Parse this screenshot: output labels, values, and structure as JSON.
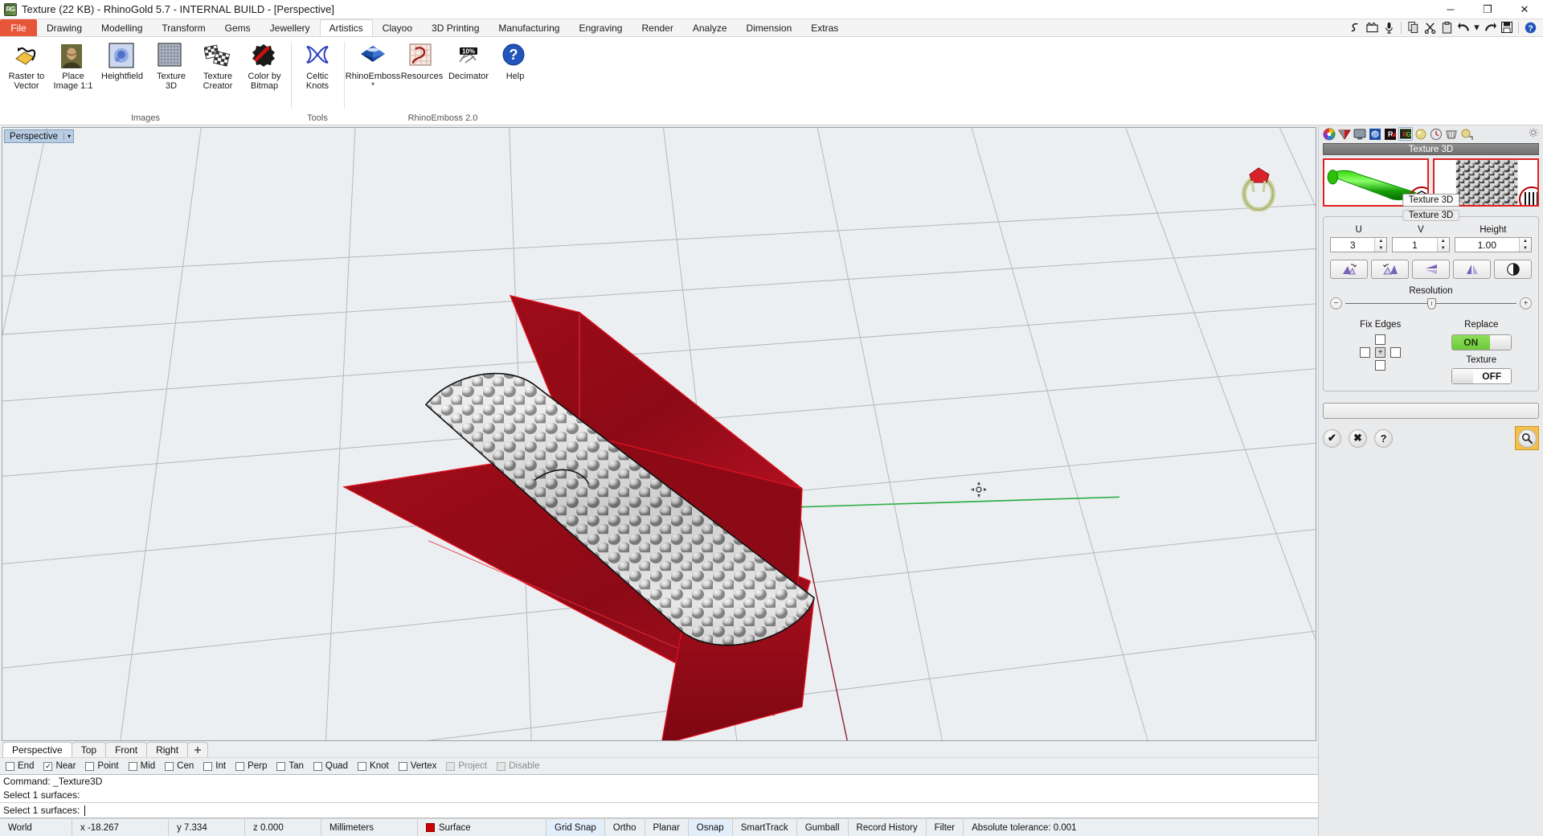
{
  "window": {
    "title": "Texture (22 KB) - RhinoGold 5.7 - INTERNAL BUILD - [Perspective]",
    "app_icon": "RG",
    "minimize": "─",
    "restore": "❐",
    "close": "✕"
  },
  "ribbon": {
    "file_tab": "File",
    "tabs": [
      {
        "label": "Drawing",
        "active": false
      },
      {
        "label": "Modelling",
        "active": false
      },
      {
        "label": "Transform",
        "active": false
      },
      {
        "label": "Gems",
        "active": false
      },
      {
        "label": "Jewellery",
        "active": false
      },
      {
        "label": "Artistics",
        "active": true
      },
      {
        "label": "Clayoo",
        "active": false
      },
      {
        "label": "3D Printing",
        "active": false
      },
      {
        "label": "Manufacturing",
        "active": false
      },
      {
        "label": "Engraving",
        "active": false
      },
      {
        "label": "Render",
        "active": false
      },
      {
        "label": "Analyze",
        "active": false
      },
      {
        "label": "Dimension",
        "active": false
      },
      {
        "label": "Extras",
        "active": false
      }
    ],
    "quick_access": [
      {
        "icon": "curve-icon",
        "glyph": "Ɛ"
      },
      {
        "icon": "animation-icon",
        "glyph": "🎬"
      },
      {
        "icon": "microphone-icon",
        "glyph": "🎤"
      },
      {
        "icon": "copy-icon",
        "glyph": "❐"
      },
      {
        "icon": "cut-icon",
        "glyph": "✂"
      },
      {
        "icon": "paste-icon",
        "glyph": "📋"
      },
      {
        "icon": "undo-icon",
        "glyph": "↶"
      },
      {
        "icon": "undo-dropdown-icon",
        "glyph": "▾"
      },
      {
        "icon": "redo-icon",
        "glyph": "↷"
      },
      {
        "icon": "save-icon",
        "glyph": "💾"
      },
      {
        "icon": "help-icon",
        "glyph": "?"
      }
    ],
    "groups": [
      {
        "label": "Images",
        "buttons": [
          {
            "label": "Raster to\nVector",
            "icon": "raster-to-vector-icon",
            "line1": "Raster to",
            "line2": "Vector"
          },
          {
            "label": "Place\nImage 1:1",
            "icon": "place-image-icon",
            "line1": "Place",
            "line2": "Image 1:1"
          },
          {
            "label": "Heightfield",
            "icon": "heightfield-icon",
            "line1": "Heightfield",
            "line2": ""
          },
          {
            "label": "Texture\n3D",
            "icon": "texture-3d-icon",
            "line1": "Texture",
            "line2": "3D"
          },
          {
            "label": "Texture\nCreator",
            "icon": "texture-creator-icon",
            "line1": "Texture",
            "line2": "Creator"
          },
          {
            "label": "Color by\nBitmap",
            "icon": "color-by-bitmap-icon",
            "line1": "Color by",
            "line2": "Bitmap"
          }
        ]
      },
      {
        "label": "Tools",
        "buttons": [
          {
            "label": "Celtic\nKnots",
            "icon": "celtic-knots-icon",
            "line1": "Celtic",
            "line2": "Knots"
          }
        ]
      },
      {
        "label": "RhinoEmboss 2.0",
        "buttons": [
          {
            "label": "RhinoEmboss",
            "icon": "rhinoemboss-icon",
            "line1": "RhinoEmboss",
            "line2": ""
          },
          {
            "label": "Resources",
            "icon": "resources-icon",
            "line1": "Resources",
            "line2": ""
          },
          {
            "label": "Decimator",
            "icon": "decimator-icon",
            "line1": "Decimator",
            "line2": "",
            "badge": "10%"
          },
          {
            "label": "Help",
            "icon": "help-round-icon",
            "line1": "Help",
            "line2": ""
          }
        ],
        "expand_glyph": "▾"
      }
    ]
  },
  "viewport": {
    "label": "Perspective",
    "dropdown_glyph": "▾",
    "view_tabs": [
      {
        "label": "Perspective",
        "active": true
      },
      {
        "label": "Top",
        "active": false
      },
      {
        "label": "Front",
        "active": false
      },
      {
        "label": "Right",
        "active": false
      },
      {
        "label": "➕",
        "active": false,
        "is_add": true
      }
    ],
    "nav_widget": "ring-gizmo-icon",
    "cursor": "rotate-cursor-icon"
  },
  "osnap": {
    "items": [
      {
        "label": "End",
        "checked": false,
        "disabled": false
      },
      {
        "label": "Near",
        "checked": true,
        "disabled": false
      },
      {
        "label": "Point",
        "checked": false,
        "disabled": false
      },
      {
        "label": "Mid",
        "checked": false,
        "disabled": false
      },
      {
        "label": "Cen",
        "checked": false,
        "disabled": false
      },
      {
        "label": "Int",
        "checked": false,
        "disabled": false
      },
      {
        "label": "Perp",
        "checked": false,
        "disabled": false
      },
      {
        "label": "Tan",
        "checked": false,
        "disabled": false
      },
      {
        "label": "Quad",
        "checked": false,
        "disabled": false
      },
      {
        "label": "Knot",
        "checked": false,
        "disabled": false
      },
      {
        "label": "Vertex",
        "checked": false,
        "disabled": false
      },
      {
        "label": "Project",
        "checked": false,
        "disabled": true
      },
      {
        "label": "Disable",
        "checked": false,
        "disabled": true
      }
    ]
  },
  "command": {
    "history": [
      "Command: _Texture3D",
      "Select 1 surfaces:"
    ],
    "prompt": "Select 1 surfaces:",
    "input_value": ""
  },
  "status": {
    "cells": [
      {
        "label": "World",
        "active": false
      },
      {
        "label": "x -18.267",
        "active": false
      },
      {
        "label": "y 7.334",
        "active": false
      },
      {
        "label": "z 0.000",
        "active": false
      },
      {
        "label": "Millimeters",
        "active": false
      },
      {
        "label": "Surface",
        "active": false,
        "swatch": "#cc0000"
      },
      {
        "label": "Grid Snap",
        "active": true
      },
      {
        "label": "Ortho",
        "active": false
      },
      {
        "label": "Planar",
        "active": false
      },
      {
        "label": "Osnap",
        "active": true
      },
      {
        "label": "SmartTrack",
        "active": false
      },
      {
        "label": "Gumball",
        "active": false
      },
      {
        "label": "Record History",
        "active": false
      },
      {
        "label": "Filter",
        "active": false
      },
      {
        "label": "Absolute tolerance: 0.001",
        "active": false
      }
    ]
  },
  "panel": {
    "icon_tabs": [
      {
        "name": "color-wheel-icon",
        "selected": false
      },
      {
        "name": "materials-icon",
        "selected": false
      },
      {
        "name": "display-icon",
        "selected": false
      },
      {
        "name": "rhino-options-icon",
        "selected": false
      },
      {
        "name": "render-icon",
        "selected": false
      },
      {
        "name": "rhinogold-icon",
        "selected": true
      },
      {
        "name": "gold-sphere-icon",
        "selected": false
      },
      {
        "name": "clock-icon",
        "selected": false
      },
      {
        "name": "ring-sizer-icon",
        "selected": false
      },
      {
        "name": "gold-bead-icon",
        "selected": false
      }
    ],
    "gear_icon": "settings-gear-icon",
    "title": "Texture 3D",
    "tooltip": "Texture 3D",
    "thumbnails": [
      {
        "name": "surface-preview-thumb",
        "badge": "cube-icon"
      },
      {
        "name": "texture-preview-thumb",
        "badge": "stripes-icon"
      }
    ],
    "group_legend": "Texture 3D",
    "fields": [
      {
        "label": "U",
        "value": "3"
      },
      {
        "label": "V",
        "value": "1"
      },
      {
        "label": "Height",
        "value": "1.00"
      }
    ],
    "tool_buttons": [
      {
        "name": "rotate-left-button"
      },
      {
        "name": "rotate-right-button"
      },
      {
        "name": "flip-vertical-button"
      },
      {
        "name": "flip-horizontal-button"
      },
      {
        "name": "invert-button"
      }
    ],
    "resolution_label": "Resolution",
    "resolution_minus": "−",
    "resolution_plus": "+",
    "resolution_position_pct": 50,
    "fix_edges_label": "Fix Edges",
    "fix_edges_center_glyph": "+",
    "replace_label": "Replace",
    "replace_state": "ON",
    "texture_label": "Texture",
    "texture_state": "OFF",
    "actions": [
      {
        "name": "accept-button",
        "glyph": "✔"
      },
      {
        "name": "cancel-button",
        "glyph": "✖"
      },
      {
        "name": "help-button",
        "glyph": "?"
      }
    ],
    "search_glyph": "🔍"
  }
}
